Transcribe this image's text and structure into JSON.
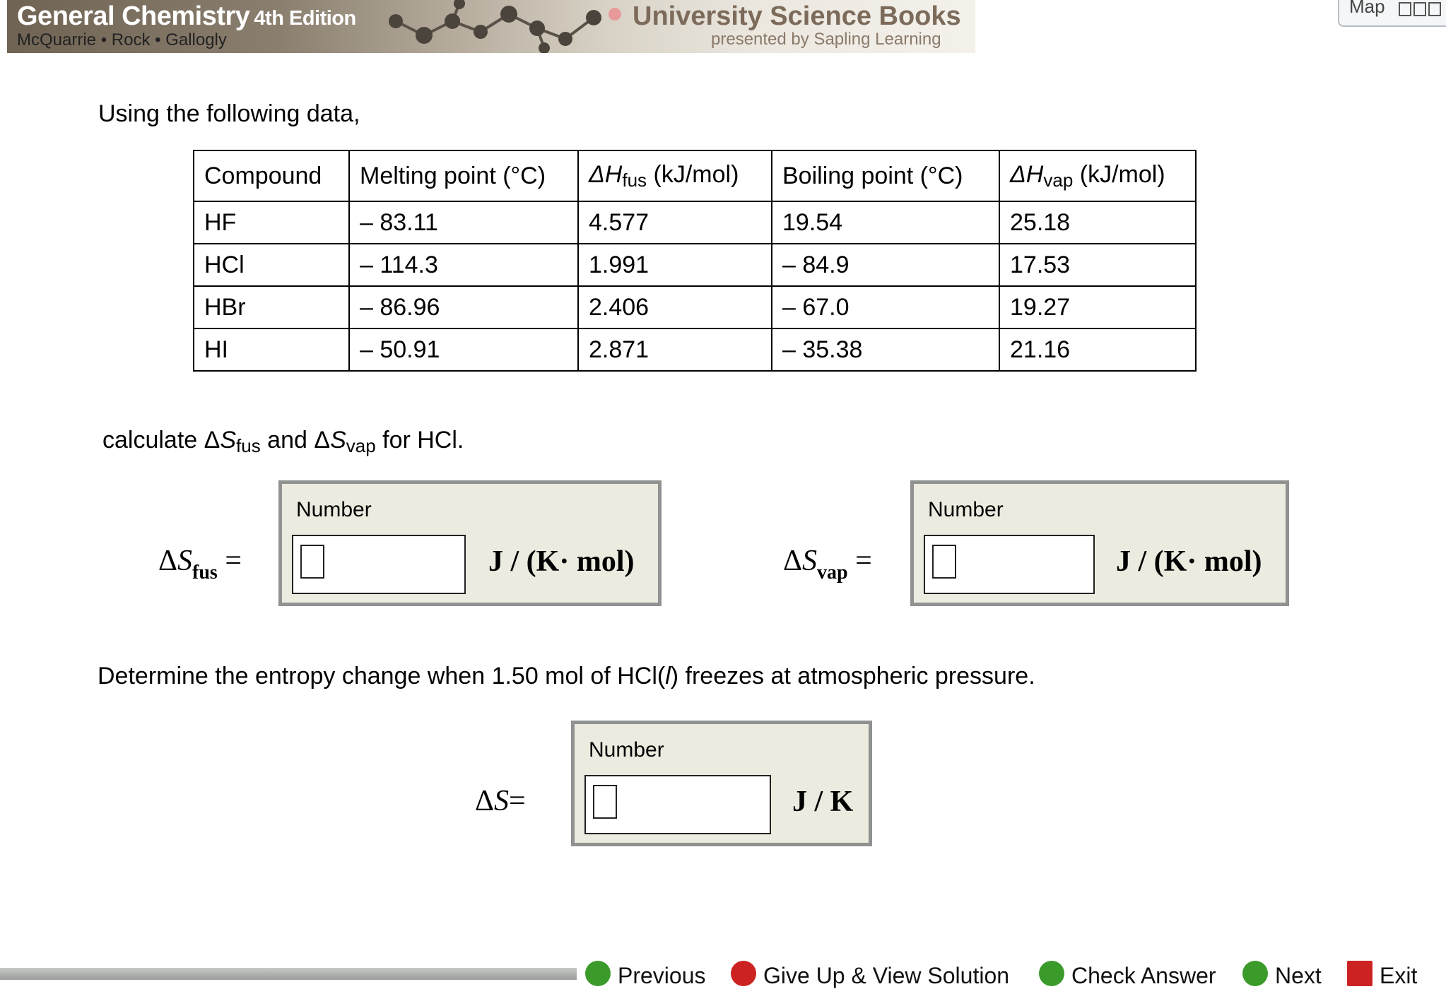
{
  "header": {
    "book_title": "General Chemistry",
    "book_edition": "4th Edition",
    "book_authors": "McQuarrie • Rock • Gallogly",
    "publisher": "University Science Books",
    "presented_by": "presented by Sapling Learning",
    "map_label": "Map"
  },
  "question": {
    "intro": "Using the following data,",
    "table": {
      "headers": [
        "Compound",
        "Melting point (°C)",
        "ΔH",
        "fus",
        " (kJ/mol)",
        "Boiling point (°C)",
        "ΔH",
        "vap",
        " (kJ/mol)"
      ],
      "rows": [
        [
          "HF",
          "– 83.11",
          "4.577",
          "19.54",
          "25.18"
        ],
        [
          "HCl",
          "– 114.3",
          "1.991",
          "– 84.9",
          "17.53"
        ],
        [
          "HBr",
          "– 86.96",
          "2.406",
          "– 67.0",
          "19.27"
        ],
        [
          "HI",
          "– 50.91",
          "2.871",
          "– 35.38",
          "21.16"
        ]
      ]
    },
    "prompt1": {
      "pre": "calculate Δ",
      "s1": "S",
      "sub1": "fus",
      "mid": " and Δ",
      "s2": "S",
      "sub2": "vap",
      "post": " for HCl."
    },
    "answer_fus": {
      "delta": "Δ",
      "symbol": "S",
      "sub": "fus",
      "eq": " =",
      "box_label": "Number",
      "value": "",
      "unit": "J / (K· mol)"
    },
    "answer_vap": {
      "delta": "Δ",
      "symbol": "S",
      "sub": "vap",
      "eq": " =",
      "box_label": "Number",
      "value": "",
      "unit": "J / (K· mol)"
    },
    "prompt2": {
      "pre": "Determine the entropy change when 1.50 mol of HCl(",
      "italic": "l",
      "post": ") freezes at atmospheric pressure."
    },
    "answer_total": {
      "delta": "Δ",
      "symbol": "S",
      "eq": "=",
      "box_label": "Number",
      "value": "",
      "unit": "J / K"
    }
  },
  "footer": {
    "previous": "Previous",
    "give_up": "Give Up & View Solution",
    "check_answer": "Check Answer",
    "next": "Next",
    "exit": "Exit"
  },
  "colors": {
    "answer_bg": "#ecebdf",
    "publisher_text": "#7c6a5a",
    "green_icon": "#3a9a2a",
    "red_icon": "#cc2222"
  }
}
